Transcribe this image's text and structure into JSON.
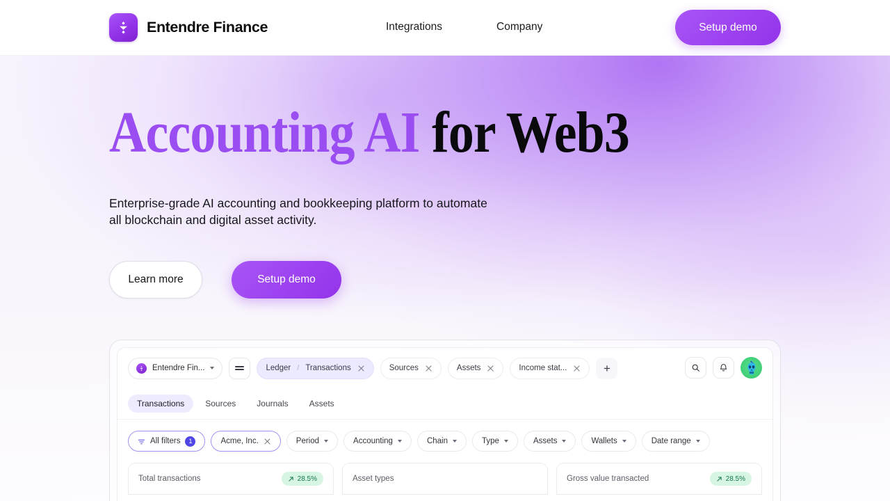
{
  "header": {
    "brand_name": "Entendre Finance",
    "brand_icon": "funnel-diamond-logo",
    "nav": [
      {
        "label": "Integrations",
        "name": "nav-integrations"
      },
      {
        "label": "Company",
        "name": "nav-company"
      }
    ],
    "cta_label": "Setup demo"
  },
  "hero": {
    "headline_accent": "Accounting AI",
    "headline_dark": " for Web3",
    "subtitle": "Enterprise-grade AI accounting and bookkeeping platform to automate all blockchain and digital asset activity.",
    "primary_cta": "Setup demo",
    "secondary_cta": "Learn more"
  },
  "app": {
    "org_selector": {
      "label": "Entendre Fin...",
      "icon": "org-logo-icon",
      "chevron": "chevron-down-icon"
    },
    "menu_icon": "hamburger-menu-icon",
    "tabs": [
      {
        "breadcrumb_parent": "Ledger",
        "separator": "/",
        "label": "Transactions",
        "active": true,
        "close": "close-icon"
      },
      {
        "label": "Sources",
        "active": false,
        "close": "close-icon"
      },
      {
        "label": "Assets",
        "active": false,
        "close": "close-icon"
      },
      {
        "label": "Income stat...",
        "active": false,
        "close": "close-icon"
      }
    ],
    "add_tab_label": "+",
    "toolbar_icons": [
      {
        "name": "search-icon",
        "glyph": "search"
      },
      {
        "name": "notification-bell-icon",
        "glyph": "bell"
      }
    ],
    "avatar": "user-avatar-skull",
    "subtabs": [
      {
        "label": "Transactions",
        "active": true
      },
      {
        "label": "Sources",
        "active": false
      },
      {
        "label": "Journals",
        "active": false
      },
      {
        "label": "Assets",
        "active": false
      }
    ],
    "filters": {
      "all_filters_label": "All filters",
      "all_filters_count": "1",
      "all_filters_icon": "filter-icon",
      "chips": [
        {
          "label": "Acme, Inc.",
          "type": "removable",
          "outlined": true
        },
        {
          "label": "Period",
          "type": "dropdown"
        },
        {
          "label": "Accounting",
          "type": "dropdown"
        },
        {
          "label": "Chain",
          "type": "dropdown"
        },
        {
          "label": "Type",
          "type": "dropdown"
        },
        {
          "label": "Assets",
          "type": "dropdown"
        },
        {
          "label": "Wallets",
          "type": "dropdown"
        },
        {
          "label": "Date range",
          "type": "dropdown"
        }
      ]
    },
    "stat_cards": [
      {
        "title": "Total transactions",
        "trend": "28.5%",
        "trend_icon": "trend-up-arrow",
        "has_trend": true
      },
      {
        "title": "Asset types",
        "trend": "",
        "has_trend": false
      },
      {
        "title": "Gross value transacted",
        "trend": "28.5%",
        "trend_icon": "trend-up-arrow",
        "has_trend": true
      }
    ]
  },
  "colors": {
    "brand_purple": "#9333ea",
    "accent_purple": "#9a4df0",
    "indigo": "#4f46e5",
    "green_badge_bg": "#d6f5e3",
    "green_badge_text": "#17794a"
  }
}
